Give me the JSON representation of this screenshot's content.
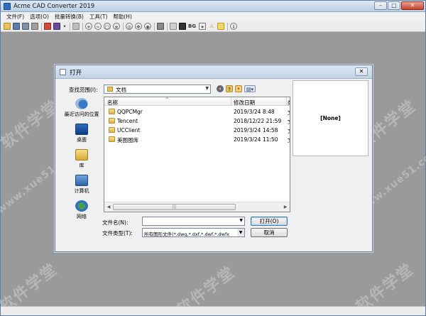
{
  "app": {
    "title": "Acme CAD Converter 2019",
    "window_buttons": {
      "minimize": "–",
      "maximize": "□",
      "close": "✕"
    }
  },
  "menu": [
    "文件(F)",
    "选项(O)",
    "批量转换(B)",
    "工具(T)",
    "帮助(H)"
  ],
  "toolbar": {
    "icons": [
      "open-icon",
      "save-icon",
      "save-all-icon",
      "print-setup-icon",
      "convert-icon",
      "batch-icon",
      "dropdown-icon",
      "print-icon",
      "zoom-in-icon",
      "zoom-out-icon",
      "zoom-window-icon",
      "zoom-realtime-icon",
      "zoom-extents-icon",
      "pan-icon",
      "view-icon",
      "layers-icon",
      "bg-toggle",
      "measure-icon",
      "warning-icon",
      "about-icon"
    ],
    "bg_label": "BG"
  },
  "watermark": {
    "cn": "软件学堂",
    "url": "www.xue51.com"
  },
  "dialog": {
    "title": "打开",
    "close_label": "✕",
    "lookin_label": "查找范围(I):",
    "lookin_value": "文档",
    "places": [
      {
        "label": "最近访问的位置",
        "icon": "recent-places-icon"
      },
      {
        "label": "桌面",
        "icon": "desktop-icon"
      },
      {
        "label": "库",
        "icon": "libraries-icon"
      },
      {
        "label": "计算机",
        "icon": "computer-icon"
      },
      {
        "label": "网络",
        "icon": "network-icon"
      }
    ],
    "columns": {
      "name": "名称",
      "date": "修改日期",
      "more": "类"
    },
    "files": [
      {
        "name": "QQPCMgr",
        "date": "2019/3/24 8:48",
        "trunc": "文"
      },
      {
        "name": "Tencent",
        "date": "2018/12/22 21:59",
        "trunc": "文"
      },
      {
        "name": "UCClient",
        "date": "2019/3/24 14:58",
        "trunc": "文"
      },
      {
        "name": "美图图库",
        "date": "2019/3/24 11:50",
        "trunc": "文"
      }
    ],
    "hscroll": {
      "left": "◀",
      "right": "▶",
      "grip": "|||"
    },
    "preview_text": "[None]",
    "filename_label": "文件名(N):",
    "filename_value": "",
    "filetype_label": "文件类型(T):",
    "filetype_value": "所有图形文件(*.dwg,*.dxf,*.dwf,*.dwfx",
    "open_button": "打开(O)",
    "cancel_button": "取消"
  }
}
